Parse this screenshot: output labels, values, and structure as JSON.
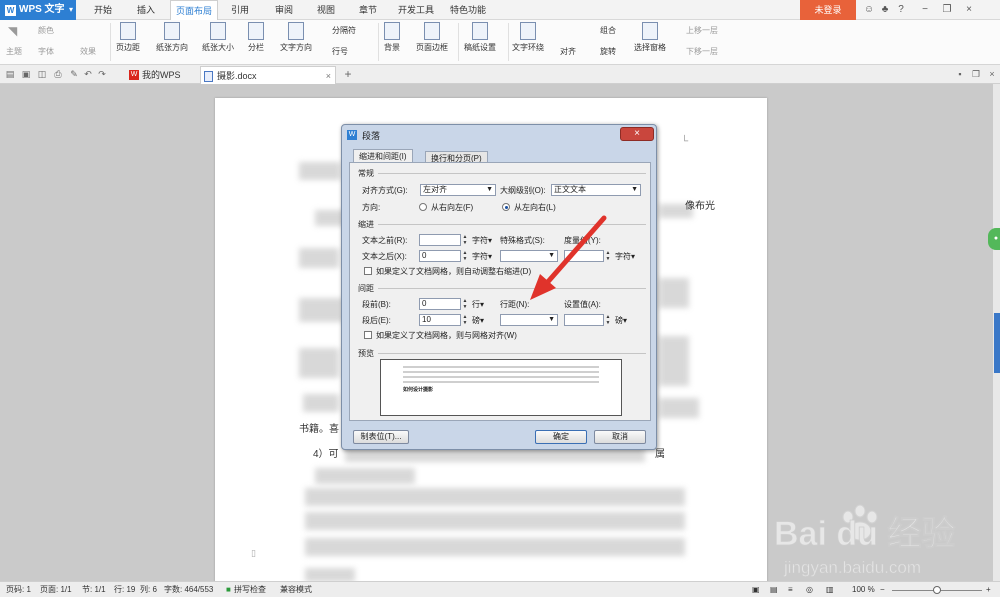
{
  "titlebar": {
    "app_name": "WPS 文字",
    "tabs": [
      "开始",
      "插入",
      "页面布局",
      "引用",
      "审阅",
      "视图",
      "章节",
      "开发工具",
      "特色功能"
    ],
    "active_tab": "页面布局",
    "login_label": "未登录",
    "help_label": "?"
  },
  "ribbon": {
    "theme": "主题",
    "color": "颜色",
    "font": "字体",
    "effect": "效果",
    "margins": "页边距",
    "orientation": "纸张方向",
    "size": "纸张大小",
    "columns": "分栏",
    "text_direction": "文字方向",
    "breaks": "分隔符",
    "line_numbers": "行号",
    "background": "背景",
    "page_border": "页面边框",
    "draft_settings": "稿纸设置",
    "wrap_text": "文字环绕",
    "align": "对齐",
    "rotate": "旋转",
    "group": "组合",
    "selection_pane": "选择窗格",
    "bring_forward": "上移一层",
    "send_backward": "下移一层"
  },
  "doc_tabs": {
    "home_tab": "我的WPS",
    "file_tab": "摄影.docx",
    "add_label": "+"
  },
  "document": {
    "text_1": "像布光",
    "text_2": "书籍。喜",
    "text_3": "4）可",
    "text_4": "属"
  },
  "dialog": {
    "title": "段落",
    "close_label": "×",
    "tabs": [
      "缩进和间距(I)",
      "换行和分页(P)"
    ],
    "general": {
      "heading": "常规",
      "alignment_label": "对齐方式(G):",
      "alignment_value": "左对齐",
      "outline_label": "大纲级别(O):",
      "outline_value": "正文文本",
      "direction_label": "方向:",
      "rtl_label": "从右向左(F)",
      "ltr_label": "从左向右(L)",
      "direction_selected": "ltr"
    },
    "indent": {
      "heading": "缩进",
      "before_label": "文本之前(R):",
      "before_value": "",
      "before_unit": "字符▾",
      "after_label": "文本之后(X):",
      "after_value": "0",
      "after_unit": "字符▾",
      "special_label": "特殊格式(S):",
      "special_value": "",
      "measure_label": "度量值(Y):",
      "measure_value": "",
      "measure_unit": "字符▾",
      "auto_adjust_label": "如果定义了文档网格，则自动调整右缩进(D)",
      "auto_adjust_checked": false
    },
    "spacing": {
      "heading": "间距",
      "before_label": "段前(B):",
      "before_value": "0",
      "before_unit": "行▾",
      "after_label": "段后(E):",
      "after_value": "10",
      "after_unit": "磅▾",
      "line_spacing_label": "行距(N):",
      "line_spacing_value": "",
      "setting_label": "设置值(A):",
      "setting_value": "",
      "setting_unit": "磅▾",
      "snap_grid_label": "如果定义了文档网格，则与网格对齐(W)",
      "snap_grid_checked": false
    },
    "preview": {
      "heading": "预览",
      "sample_text": "如何设计摄影"
    },
    "buttons": {
      "tabs": "制表位(T)...",
      "ok": "确定",
      "cancel": "取消"
    }
  },
  "statusbar": {
    "page_num": "页码: 1",
    "pages": "页面: 1/1",
    "section": "节: 1/1",
    "row": "行: 19",
    "col": "列: 6",
    "words": "字数: 464/553",
    "spell": "拼写检查",
    "compat": "兼容模式",
    "zoom": "100 %",
    "zoom_fraction": 0.5
  },
  "watermark": {
    "brand": "Bai du 经验",
    "url": "jingyan.baidu.com"
  },
  "colors": {
    "accent": "#2d7fd3",
    "login": "#e8623a",
    "arrow": "#e0332b"
  }
}
